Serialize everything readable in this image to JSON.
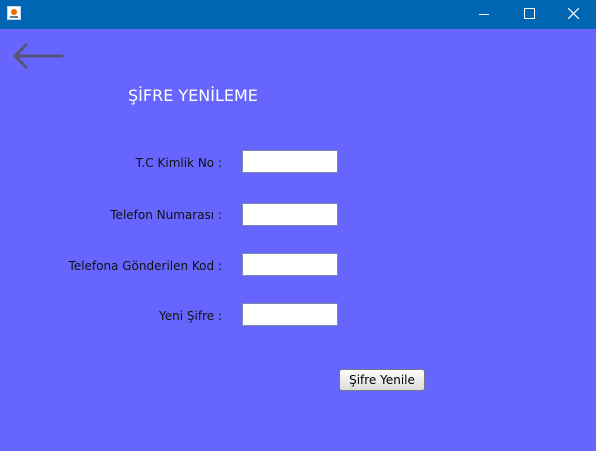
{
  "window": {
    "title": "",
    "controls": [
      "minimize-icon",
      "maximize-icon",
      "close-icon"
    ]
  },
  "colors": {
    "background": "#6666FF",
    "titlebar": "#0065B3"
  },
  "back": {
    "icon": "arrow-left-icon"
  },
  "form": {
    "heading": "ŞİFRE YENİLEME",
    "fields": [
      {
        "label": "T.C Kimlik No :",
        "value": ""
      },
      {
        "label": "Telefon Numarası :",
        "value": ""
      },
      {
        "label": "Telefona Gönderilen Kod :",
        "value": ""
      },
      {
        "label": "Yeni Şifre :",
        "value": ""
      }
    ],
    "submit_label": "Şifre Yenile"
  }
}
